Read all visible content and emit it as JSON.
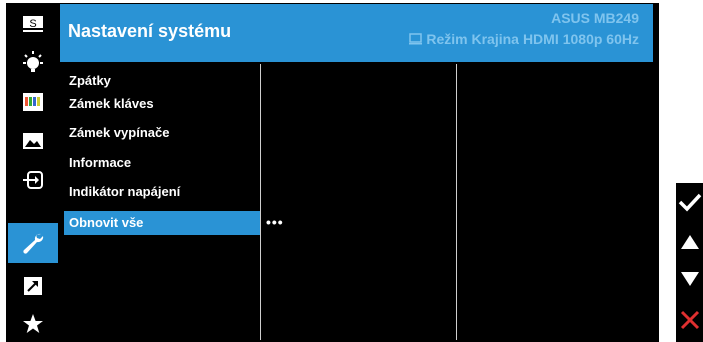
{
  "header": {
    "title": "Nastavení systému",
    "model": "ASUS MB249",
    "mode": "Režim Krajina",
    "input": "HDMI",
    "resolution": "1080p 60Hz"
  },
  "sidebar": {
    "items": [
      {
        "icon": "splendid-s-icon"
      },
      {
        "icon": "bluelight-bulb-icon"
      },
      {
        "icon": "color-bars-icon"
      },
      {
        "icon": "image-icon"
      },
      {
        "icon": "input-select-icon"
      },
      {
        "icon": "wrench-icon",
        "active": true
      },
      {
        "icon": "shortcut-arrow-icon"
      },
      {
        "icon": "favorite-star-icon"
      }
    ]
  },
  "menu": {
    "items": [
      "Zpátky",
      "Zámek kláves",
      "Zámek vypínače",
      "Informace",
      "Indikátor napájení",
      "Obnovit vše"
    ],
    "selected_index": 5,
    "submenu_value": "•••"
  },
  "colors": {
    "accent": "#2a93d5",
    "header_text_dim": "#7fc4ee",
    "close_red": "#e03030"
  },
  "keys": [
    "checkmark-icon",
    "up-arrow-icon",
    "down-arrow-icon",
    "close-icon"
  ]
}
